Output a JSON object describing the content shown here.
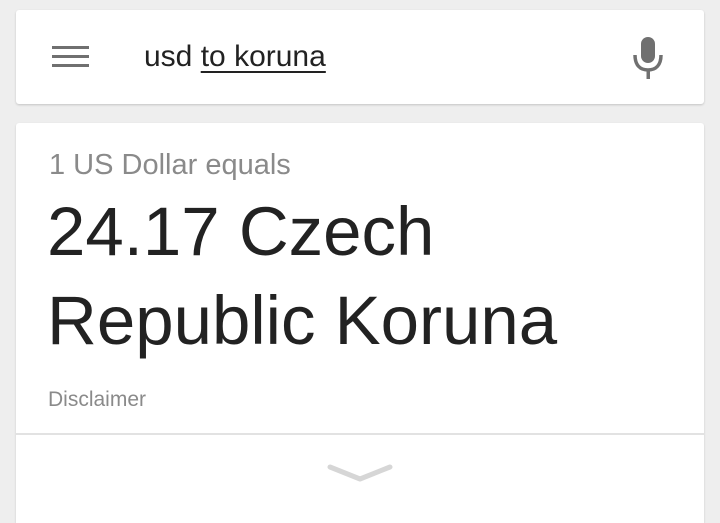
{
  "search": {
    "query_prefix": "usd",
    "query_underlined": "to koruna"
  },
  "result": {
    "equals_label": "1 US Dollar equals",
    "conversion": "24.17 Czech Republic Koruna",
    "disclaimer_label": "Disclaimer"
  },
  "icons": {
    "menu": "menu-icon",
    "mic": "mic-icon",
    "expand": "chevron-down-icon"
  },
  "colors": {
    "background": "#eeeeee",
    "card": "#ffffff",
    "primary_text": "#222222",
    "secondary_text": "#8a8a8a",
    "icon": "#707070"
  }
}
